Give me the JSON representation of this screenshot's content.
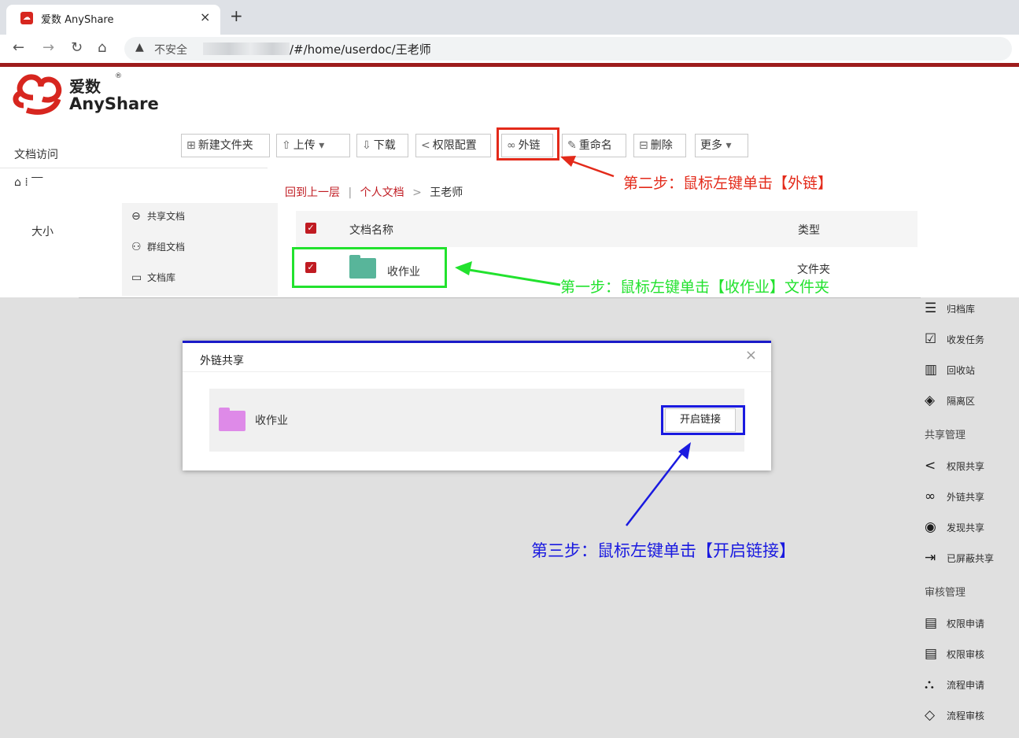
{
  "browser": {
    "tab_title": "爱数 AnyShare",
    "tab_close": "×",
    "new_tab": "+",
    "insecure_label": "不安全",
    "url": "/#/home/userdoc/王老师"
  },
  "app": {
    "logo_cn": "爱数",
    "logo_en": "AnyShare",
    "logo_reg": "®"
  },
  "toolbar": {
    "new_folder": "新建文件夹",
    "upload": "上传",
    "download": "下载",
    "permission": "权限配置",
    "external_link": "外链",
    "rename": "重命名",
    "delete": "删除",
    "more": "更多"
  },
  "leftnav": {
    "title": "文档访问",
    "size_col": "大小",
    "sub": [
      "共享文档",
      "群组文档",
      "文档库"
    ]
  },
  "breadcrumb": {
    "back": "回到上一层",
    "divider": "|",
    "personal": "个人文档",
    "sep": ">",
    "current": "王老师"
  },
  "table": {
    "col_name": "文档名称",
    "col_type": "类型",
    "rows": [
      {
        "name": "收作业",
        "type": "文件夹"
      }
    ]
  },
  "right_panel": {
    "items_top": [
      "归档库",
      "收发任务",
      "回收站",
      "隔离区"
    ],
    "group_share": "共享管理",
    "items_share": [
      "权限共享",
      "外链共享",
      "发现共享",
      "已屏蔽共享"
    ],
    "group_review": "审核管理",
    "items_review": [
      "权限申请",
      "权限审核",
      "流程申请",
      "流程审核"
    ]
  },
  "dialog": {
    "title": "外链共享",
    "close": "×",
    "file_name": "收作业",
    "open_link": "开启链接"
  },
  "annotations": {
    "step1": "第一步：鼠标左键单击【收作业】文件夹",
    "step2": "第二步：鼠标左键单击【外链】",
    "step3": "第三步：鼠标左键单击【开启链接】"
  },
  "colors": {
    "brand_red": "#c01b22",
    "annotation_red": "#e32a1a",
    "annotation_green": "#22e22e",
    "annotation_blue": "#1a1ae0",
    "folder_teal": "#58b59a",
    "folder_pink": "#de8ae8"
  }
}
